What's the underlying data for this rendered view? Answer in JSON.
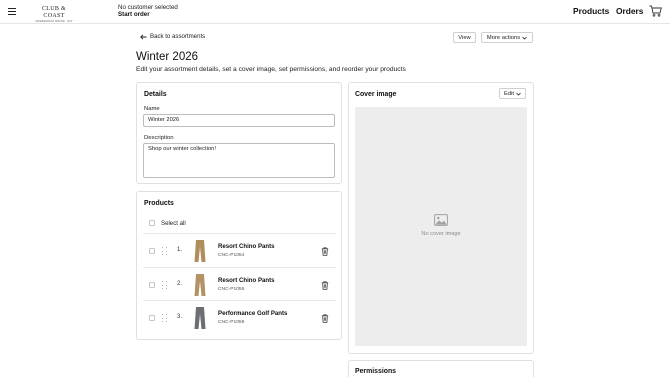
{
  "header": {
    "logo_main": "CLUB & COAST",
    "logo_sub": "INDEPENDENT BRAND · EST",
    "customer_status": "No customer selected",
    "start_order": "Start order",
    "nav": {
      "products": "Products",
      "orders": "Orders"
    }
  },
  "toolbar": {
    "back": "Back to assortments",
    "view": "View",
    "more_actions": "More actions"
  },
  "page": {
    "title": "Winter 2026",
    "subtitle": "Edit your assortment details, set a cover image, set permissions, and reorder your products"
  },
  "details": {
    "title": "Details",
    "name_label": "Name",
    "name_value": "Winter 2026",
    "description_label": "Description",
    "description_value": "Shop our winter collection!"
  },
  "products": {
    "title": "Products",
    "select_all": "Select all",
    "items": [
      {
        "index": "1.",
        "name": "Resort Chino Pants",
        "sku": "CNC-P1054",
        "color": "#b08d5c"
      },
      {
        "index": "2.",
        "name": "Resort Chino Pants",
        "sku": "CNC-P1055",
        "color": "#b39366"
      },
      {
        "index": "3.",
        "name": "Performance Golf Pants",
        "sku": "CNC-P1059",
        "color": "#6b6e72"
      }
    ]
  },
  "cover": {
    "title": "Cover image",
    "edit": "Edit",
    "empty_text": "No cover image"
  },
  "permissions": {
    "title": "Permissions"
  }
}
